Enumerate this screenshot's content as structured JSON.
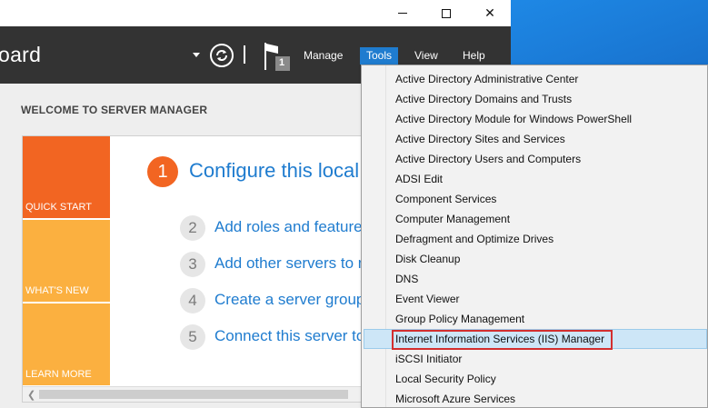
{
  "window": {
    "dashboard_title": "oard",
    "controls": {
      "minimize": "minimize-icon",
      "maximize": "maximize-icon",
      "close": "✕"
    }
  },
  "toolbar": {
    "notification_count": "1",
    "menu": {
      "manage": "Manage",
      "tools": "Tools",
      "view": "View",
      "help": "Help"
    }
  },
  "main": {
    "welcome": "WELCOME TO SERVER MANAGER",
    "tiles": [
      "QUICK START",
      "WHAT'S NEW",
      "LEARN MORE"
    ],
    "step1": {
      "number": "1",
      "text": "Configure this local server"
    },
    "steps": [
      {
        "number": "2",
        "text": "Add roles and features"
      },
      {
        "number": "3",
        "text": "Add other servers to manage"
      },
      {
        "number": "4",
        "text": "Create a server group"
      },
      {
        "number": "5",
        "text": "Connect this server to cloud services"
      }
    ]
  },
  "tools_menu": {
    "items": [
      "Active Directory Administrative Center",
      "Active Directory Domains and Trusts",
      "Active Directory Module for Windows PowerShell",
      "Active Directory Sites and Services",
      "Active Directory Users and Computers",
      "ADSI Edit",
      "Component Services",
      "Computer Management",
      "Defragment and Optimize Drives",
      "Disk Cleanup",
      "DNS",
      "Event Viewer",
      "Group Policy Management",
      "Internet Information Services (IIS) Manager",
      "iSCSI Initiator",
      "Local Security Policy",
      "Microsoft Azure Services"
    ],
    "highlighted_index": 13
  }
}
